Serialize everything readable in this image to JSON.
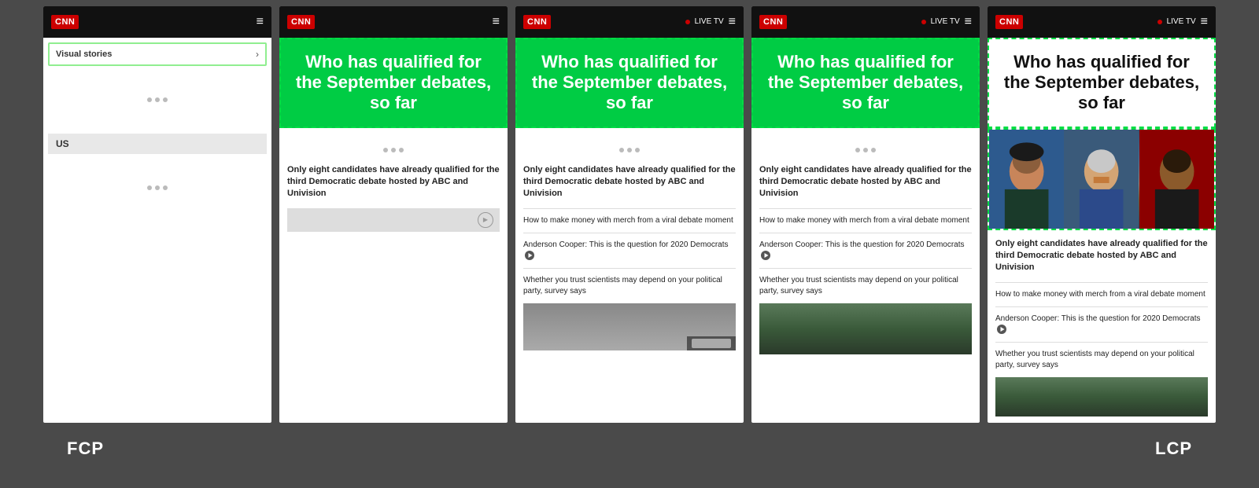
{
  "labels": {
    "fcp": "FCP",
    "lcp": "LCP"
  },
  "cnn": {
    "logo": "CNN",
    "hamburger": "≡",
    "live_tv": "LIVE TV"
  },
  "frame1": {
    "visual_stories": "Visual stories",
    "us_label": "US"
  },
  "headlines": {
    "main_title": "Who has qualified for the September debates, so far",
    "main_article": "Only eight candidates have already qualified for the third Democratic debate hosted by ABC and Univision",
    "sub1": "How to make money with merch from a viral debate moment",
    "sub2": "Anderson Cooper: This is the question for 2020 Democrats",
    "sub3": "Whether you trust scientists may depend on your political party, survey says"
  }
}
